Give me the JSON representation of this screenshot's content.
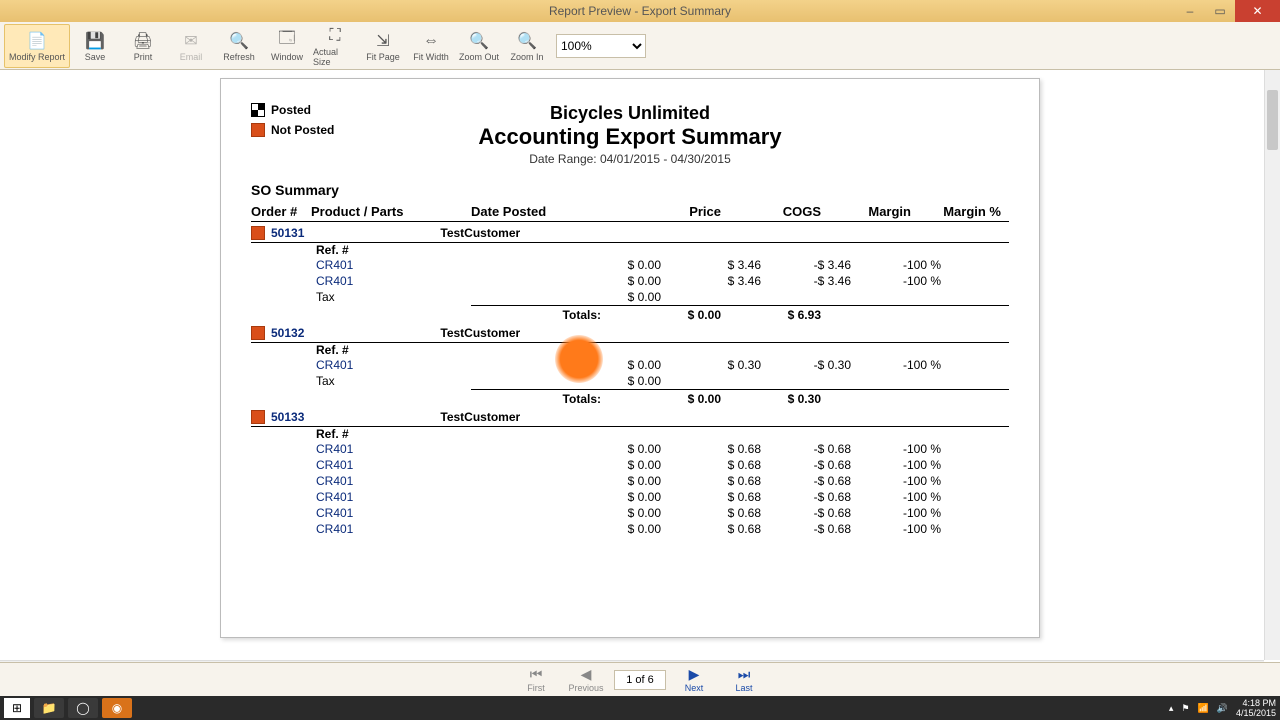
{
  "window": {
    "title": "Report Preview - Export Summary"
  },
  "toolbar": {
    "modify": "Modify Report",
    "save": "Save",
    "print": "Print",
    "email": "Email",
    "refresh": "Refresh",
    "window": "Window",
    "actualsize": "Actual Size",
    "fitpage": "Fit Page",
    "fitwidth": "Fit Width",
    "zoomout": "Zoom Out",
    "zoomin": "Zoom In",
    "zoom": "100%"
  },
  "legend": {
    "posted": "Posted",
    "notposted": "Not Posted"
  },
  "report": {
    "company": "Bicycles Unlimited",
    "title": "Accounting Export Summary",
    "daterange": "Date Range: 04/01/2015 - 04/30/2015",
    "section": "SO Summary",
    "cols": {
      "order": "Order #",
      "prod": "Product / Parts",
      "date": "Date Posted",
      "price": "Price",
      "cogs": "COGS",
      "margin": "Margin",
      "mpct": "Margin %"
    },
    "totals_label": "Totals:",
    "ref_label": "Ref. #",
    "tax_label": "Tax"
  },
  "orders": [
    {
      "num": "50131",
      "customer": "TestCustomer",
      "lines": [
        {
          "prod": "CR401",
          "price": "$ 0.00",
          "cogs": "$ 3.46",
          "margin": "-$ 3.46",
          "mpct": "-100 %"
        },
        {
          "prod": "CR401",
          "price": "$ 0.00",
          "cogs": "$ 3.46",
          "margin": "-$ 3.46",
          "mpct": "-100 %"
        }
      ],
      "tax_price": "$ 0.00",
      "totals": {
        "price": "$ 0.00",
        "cogs": "$ 6.93"
      }
    },
    {
      "num": "50132",
      "customer": "TestCustomer",
      "lines": [
        {
          "prod": "CR401",
          "price": "$ 0.00",
          "cogs": "$ 0.30",
          "margin": "-$ 0.30",
          "mpct": "-100 %"
        }
      ],
      "tax_price": "$ 0.00",
      "totals": {
        "price": "$ 0.00",
        "cogs": "$ 0.30"
      }
    },
    {
      "num": "50133",
      "customer": "TestCustomer",
      "lines": [
        {
          "prod": "CR401",
          "price": "$ 0.00",
          "cogs": "$ 0.68",
          "margin": "-$ 0.68",
          "mpct": "-100 %"
        },
        {
          "prod": "CR401",
          "price": "$ 0.00",
          "cogs": "$ 0.68",
          "margin": "-$ 0.68",
          "mpct": "-100 %"
        },
        {
          "prod": "CR401",
          "price": "$ 0.00",
          "cogs": "$ 0.68",
          "margin": "-$ 0.68",
          "mpct": "-100 %"
        },
        {
          "prod": "CR401",
          "price": "$ 0.00",
          "cogs": "$ 0.68",
          "margin": "-$ 0.68",
          "mpct": "-100 %"
        },
        {
          "prod": "CR401",
          "price": "$ 0.00",
          "cogs": "$ 0.68",
          "margin": "-$ 0.68",
          "mpct": "-100 %"
        },
        {
          "prod": "CR401",
          "price": "$ 0.00",
          "cogs": "$ 0.68",
          "margin": "-$ 0.68",
          "mpct": "-100 %"
        }
      ]
    }
  ],
  "nav": {
    "first": "First",
    "previous": "Previous",
    "next": "Next",
    "last": "Last",
    "page": "1 of 6"
  },
  "taskbar": {
    "time": "4:18 PM",
    "date": "4/15/2015"
  }
}
